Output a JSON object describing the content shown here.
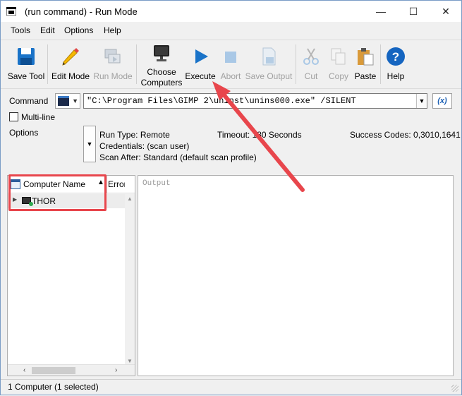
{
  "window": {
    "title": "(run command) - Run Mode",
    "minimize": "—",
    "maximize": "☐",
    "close": "✕"
  },
  "menu": [
    "Tools",
    "Edit",
    "Options",
    "Help"
  ],
  "toolbar": {
    "save_tool": "Save Tool",
    "edit_mode": "Edit Mode",
    "run_mode": "Run Mode",
    "choose_computers_1": "Choose",
    "choose_computers_2": "Computers",
    "execute": "Execute",
    "abort": "Abort",
    "save_output": "Save Output",
    "cut": "Cut",
    "copy": "Copy",
    "paste": "Paste",
    "help": "Help"
  },
  "command": {
    "label": "Command",
    "value": "\"C:\\Program Files\\GIMP 2\\uninst\\unins000.exe\" /SILENT",
    "var_button": "(x)"
  },
  "multiline": {
    "label": "Multi-line"
  },
  "options": {
    "label": "Options",
    "run_type": "Run Type: Remote",
    "timeout": "Timeout: 180 Seconds",
    "success_codes": "Success Codes: 0,3010,1641",
    "credentials": "Credentials: (scan user)",
    "scan_after": "Scan After:  Standard (default scan profile)"
  },
  "grid": {
    "col_computer": "Computer Name",
    "col_error": "Error",
    "rows": [
      {
        "name": "THOR"
      }
    ]
  },
  "output": {
    "placeholder": "Output"
  },
  "status": {
    "text": "1 Computer (1 selected)"
  },
  "colors": {
    "highlight": "#e8464c",
    "execute_blue": "#1a73c8",
    "help_blue": "#1565c0"
  }
}
